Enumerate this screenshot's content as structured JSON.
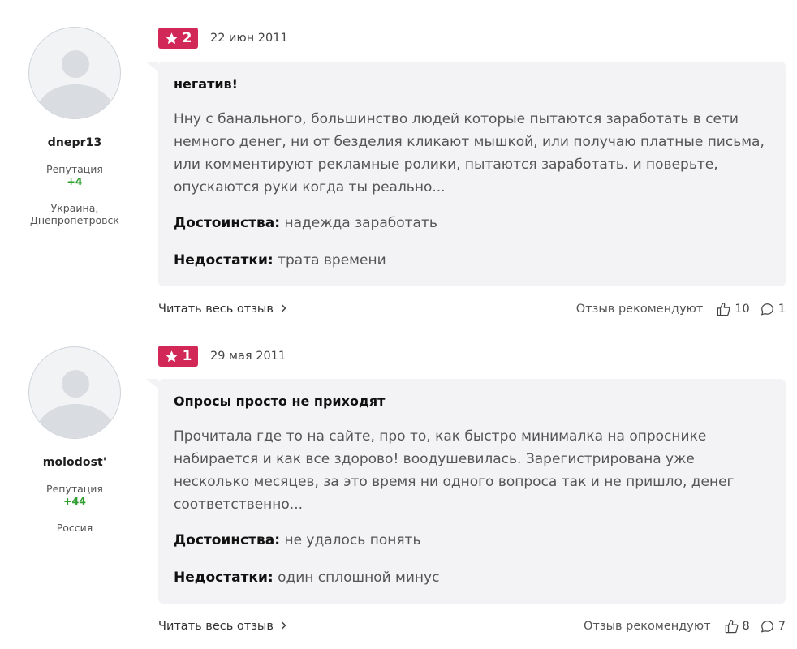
{
  "reviews": [
    {
      "author": {
        "name": "dnepr13",
        "reputation_label": "Репутация",
        "reputation_value": "+4",
        "location": "Украина, Днепропетровск"
      },
      "rating": "2",
      "date": "22 июн 2011",
      "title": "негатив!",
      "text": "Нну с банального, большинство людей которые пытаются заработать в сети немного денег, ни от безделия кликают мышкой, или получаю платные письма, или комментируют рекламные ролики, пытаются заработать. и поверьте, опускаются руки когда ты реально...",
      "pros_label": "Достоинства:",
      "pros": "надежда заработать",
      "cons_label": "Недостатки:",
      "cons": "трата времени",
      "read_more": "Читать весь отзыв",
      "recommend_label": "Отзыв рекомендуют",
      "likes": "10",
      "comments": "1"
    },
    {
      "author": {
        "name": "molodost'",
        "reputation_label": "Репутация",
        "reputation_value": "+44",
        "location": "Россия"
      },
      "rating": "1",
      "date": "29 мая 2011",
      "title": "Опросы просто не приходят",
      "text": "Прочитала где то на сайте, про то, как быстро минималка на опроснике набирается и как все здорово! воодушевилась. Зарегистрирована уже несколько месяцев, за это время ни одного вопроса так и не пришло, денег соответственно...",
      "pros_label": "Достоинства:",
      "pros": "не удалось понять",
      "cons_label": "Недостатки:",
      "cons": "один сплошной минус",
      "read_more": "Читать весь отзыв",
      "recommend_label": "Отзыв рекомендуют",
      "likes": "8",
      "comments": "7"
    }
  ],
  "icons": {
    "star": "star-icon",
    "like": "thumbs-up-icon",
    "comment": "comment-icon",
    "chevron": "chevron-right-icon"
  },
  "colors": {
    "badge": "#d12857",
    "reputation": "#2e9e2e",
    "card_bg": "#f3f3f5"
  }
}
